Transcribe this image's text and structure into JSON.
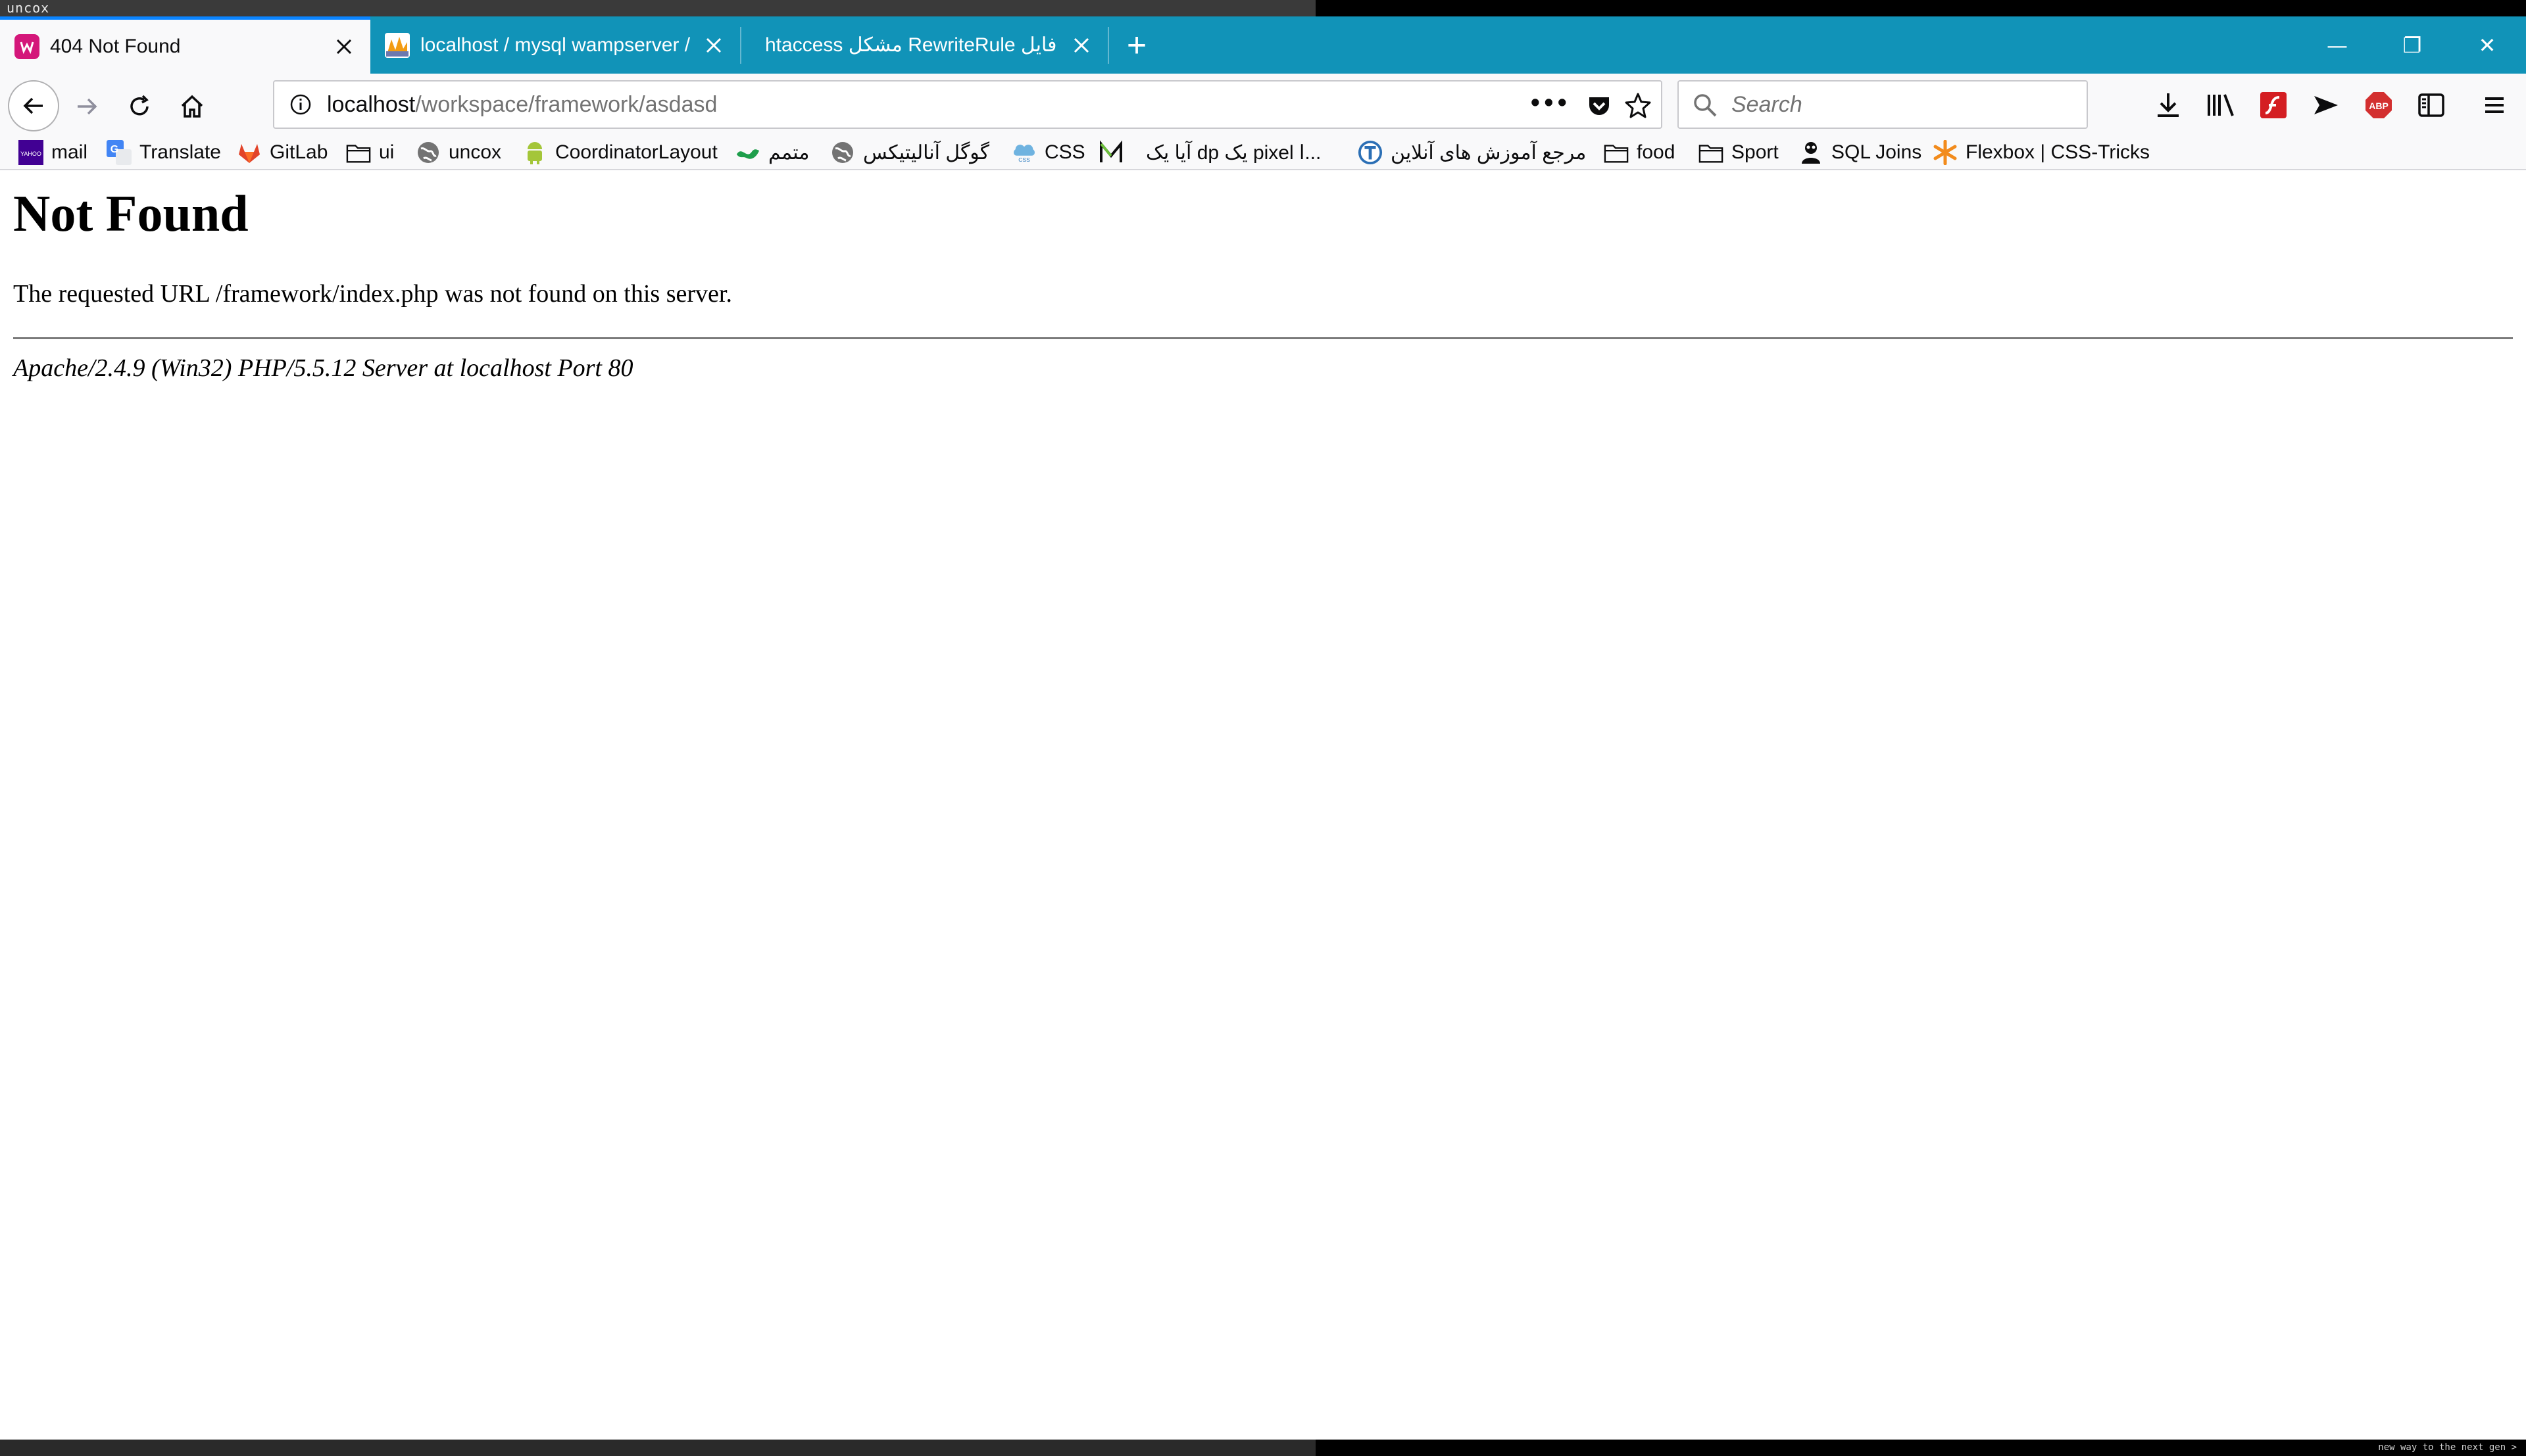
{
  "desktop": {
    "brand": "uncox",
    "tagline": "new way to the next gen >"
  },
  "tabs": [
    {
      "title": "404 Not Found",
      "active": true,
      "favicon": "wamp-icon"
    },
    {
      "title": "localhost / mysql wampserver / ",
      "active": false,
      "favicon": "phpmyadmin-icon"
    },
    {
      "title": "htaccess مشکل RewriteRule در فایل",
      "active": false,
      "favicon": "none"
    }
  ],
  "window": {
    "new_tab_glyph": "+",
    "minimize_glyph": "—",
    "restore_glyph": "❐",
    "close_glyph": "✕"
  },
  "nav": {
    "url_host": "localhost",
    "url_path": "/workspace/framework/asdasd",
    "page_actions_glyph": "•••",
    "search_placeholder": "Search"
  },
  "bookmarks": [
    {
      "label": "mail",
      "icon": "yahoo-mail-icon"
    },
    {
      "label": "Translate",
      "icon": "google-translate-icon"
    },
    {
      "label": "GitLab",
      "icon": "gitlab-icon"
    },
    {
      "label": "ui",
      "icon": "folder-icon"
    },
    {
      "label": "uncox",
      "icon": "globe-icon"
    },
    {
      "label": "CoordinatorLayout",
      "icon": "android-icon"
    },
    {
      "label": "متمم",
      "icon": "motamem-icon"
    },
    {
      "label": "گوگل آنالیتیکس",
      "icon": "globe-icon"
    },
    {
      "label": "CSS",
      "icon": "css-icon"
    },
    {
      "label": "",
      "icon": "m-logo-icon"
    },
    {
      "label": "آیا یک dp یک pixel ا...",
      "icon": "none"
    },
    {
      "label": "مرجع آموزش های آنلاین",
      "icon": "t-logo-icon"
    },
    {
      "label": "food",
      "icon": "folder-icon"
    },
    {
      "label": "Sport",
      "icon": "folder-icon"
    },
    {
      "label": "SQL Joins",
      "icon": "sql-joins-icon"
    },
    {
      "label": "Flexbox | CSS-Tricks",
      "icon": "css-tricks-star-icon"
    }
  ],
  "page": {
    "heading": "Not Found",
    "message": "The requested URL /framework/index.php was not found on this server.",
    "address": "Apache/2.4.9 (Win32) PHP/5.5.12 Server at localhost Port 80"
  },
  "colors": {
    "tab_strip": "#1193b8",
    "active_tab_highlight": "#0a84ff",
    "toolbar": "#f9f9fa"
  }
}
